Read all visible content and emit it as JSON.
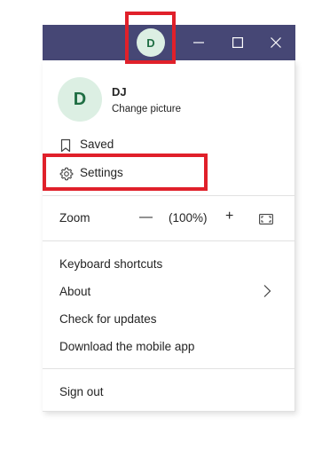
{
  "titlebar": {
    "avatar_initial": "D",
    "minimize_icon": "minimize-icon",
    "maximize_icon": "maximize-icon",
    "close_icon": "close-icon"
  },
  "profile": {
    "initial": "D",
    "name": "DJ",
    "change_picture": "Change picture"
  },
  "menu": {
    "saved": {
      "label": "Saved",
      "icon": "bookmark-icon"
    },
    "settings": {
      "label": "Settings",
      "icon": "gear-icon"
    },
    "zoom": {
      "label": "Zoom",
      "decrease": "—",
      "value": "(100%)",
      "increase": "+",
      "fit_icon": "fit-to-screen-icon"
    },
    "keyboard_shortcuts": "Keyboard shortcuts",
    "about": "About",
    "check_updates": "Check for updates",
    "download_mobile": "Download the mobile app",
    "sign_out": "Sign out"
  },
  "colors": {
    "titlebar": "#464775",
    "avatar_bg": "#dcefe3",
    "avatar_text": "#1f6e43",
    "highlight": "#e0202a"
  }
}
